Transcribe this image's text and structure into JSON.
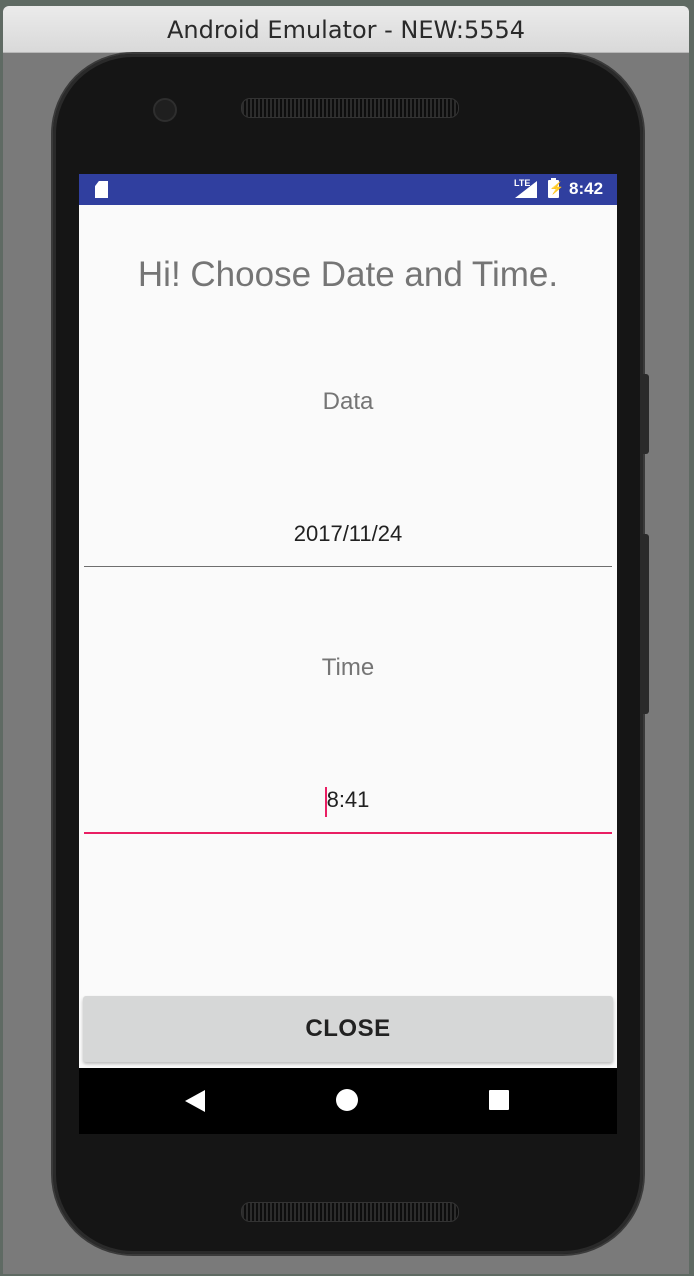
{
  "window": {
    "title": "Android Emulator - NEW:5554"
  },
  "status_bar": {
    "network": "LTE",
    "time": "8:42",
    "icons": [
      "sd-card-icon",
      "signal-icon",
      "battery-charging-icon"
    ],
    "color": "#303f9f"
  },
  "app": {
    "headline": "Hi! Choose Date and Time.",
    "date_field": {
      "label": "Data",
      "value": "2017/11/24"
    },
    "time_field": {
      "label": "Time",
      "value": "8:41"
    },
    "close_button": "CLOSE",
    "accent_color": "#e91e63"
  },
  "nav_bar": {
    "icons": [
      "back-icon",
      "home-icon",
      "recents-icon"
    ]
  }
}
